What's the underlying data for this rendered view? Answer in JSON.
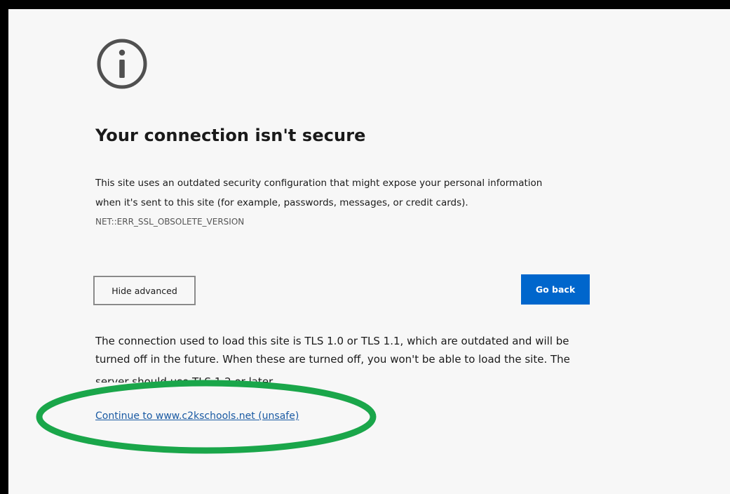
{
  "page": {
    "icon": "info-circle-icon",
    "title": "Your connection isn't secure",
    "description_lines": [
      "This site uses an outdated security configuration that might expose your personal information",
      "when it's sent to this site (for example, passwords, messages, or credit cards)."
    ],
    "error_code": "NET::ERR_SSL_OBSOLETE_VERSION",
    "buttons": {
      "hide_advanced": "Hide advanced",
      "go_back": "Go back"
    },
    "details_lines": [
      "The connection used to load this site is TLS 1.0 or TLS 1.1, which are outdated and will be",
      "turned off in the future. When these are turned off, you won't be able to load the site. The",
      "server should use TLS 1.2 or later."
    ],
    "continue_link": "Continue to www.c2kschools.net (unsafe)"
  },
  "colors": {
    "page_background": "#f7f7f7",
    "primary_button": "#0066cc",
    "link": "#1a5aa3",
    "annotation_ellipse": "#1aa64a"
  }
}
